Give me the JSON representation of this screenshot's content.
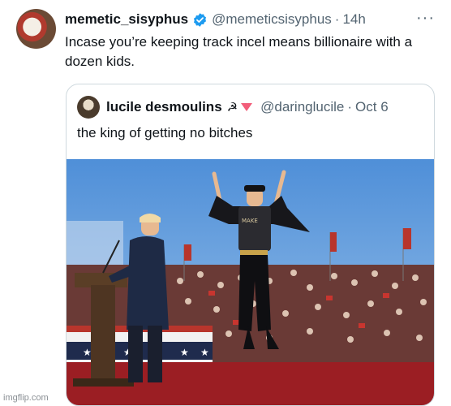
{
  "post": {
    "display_name": "memetic_sisyphus",
    "handle": "@memeticsisyphus",
    "separator": "·",
    "time": "14h",
    "more_icon": "···",
    "text": "Incase you’re keeping track incel means billionaire with a dozen kids."
  },
  "quoted_post": {
    "display_name": "lucile desmoulins",
    "emoji": "☭",
    "handle": "@daringlucile",
    "separator": "·",
    "date": "Oct 6",
    "text": "the king of getting no bitches"
  },
  "watermark": "imgflip.com",
  "colors": {
    "verified_blue": "#1d9bf0",
    "muted_text": "#536471",
    "border": "#cfd9de",
    "triangle": "#f25e7a"
  }
}
